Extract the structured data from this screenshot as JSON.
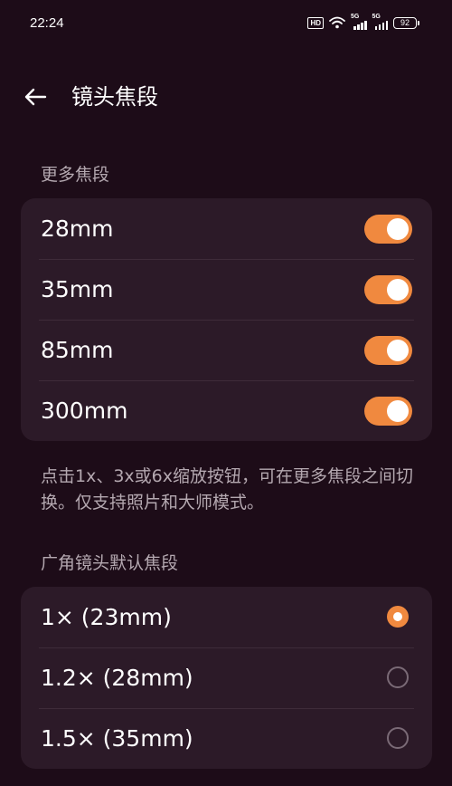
{
  "status_bar": {
    "time": "22:24",
    "hd_badge": "HD",
    "network_1": "5G",
    "network_2": "5G",
    "battery": "92",
    "icons": [
      "hd-icon",
      "wifi-icon",
      "signal-5g-icon",
      "signal-5g-icon",
      "battery-icon"
    ]
  },
  "header": {
    "title": "镜头焦段",
    "back_icon": "arrow-left-icon"
  },
  "more_focal": {
    "header": "更多焦段",
    "items": [
      {
        "label": "28mm",
        "enabled": true
      },
      {
        "label": "35mm",
        "enabled": true
      },
      {
        "label": "85mm",
        "enabled": true
      },
      {
        "label": "300mm",
        "enabled": true
      }
    ],
    "description": "点击1x、3x或6x缩放按钮，可在更多焦段之间切换。仅支持照片和大师模式。"
  },
  "default_focal": {
    "header": "广角镜头默认焦段",
    "options": [
      {
        "label": "1× (23mm)",
        "selected": true
      },
      {
        "label": "1.2× (28mm)",
        "selected": false
      },
      {
        "label": "1.5× (35mm)",
        "selected": false
      }
    ]
  },
  "colors": {
    "background": "#1d0c18",
    "card": "#2c1a28",
    "accent": "#f0893f",
    "secondary_text": "#b4a8b0"
  }
}
